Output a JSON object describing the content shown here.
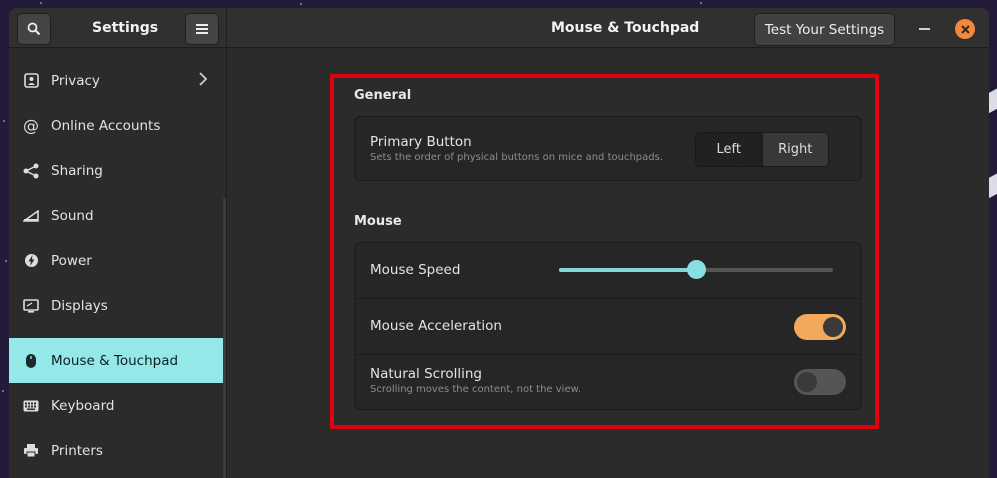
{
  "header": {
    "search_icon": "search-icon",
    "menu_icon": "hamburger-menu-icon",
    "sidebar_title": "Settings",
    "page_title": "Mouse & Touchpad",
    "test_button": "Test Your Settings",
    "accent": "#94e8e8",
    "close_color": "#f0883e"
  },
  "sidebar": {
    "items": [
      {
        "label": "Privacy",
        "icon": "privacy-icon"
      },
      {
        "label": "Online Accounts",
        "icon": "at-icon"
      },
      {
        "label": "Sharing",
        "icon": "share-icon"
      },
      {
        "label": "Sound",
        "icon": "sound-icon"
      },
      {
        "label": "Power",
        "icon": "power-icon"
      },
      {
        "label": "Displays",
        "icon": "display-icon"
      },
      {
        "label": "Mouse & Touchpad",
        "icon": "mouse-icon",
        "active": true
      },
      {
        "label": "Keyboard",
        "icon": "keyboard-icon"
      },
      {
        "label": "Printers",
        "icon": "printer-icon"
      }
    ]
  },
  "general": {
    "title": "General",
    "primary_button": {
      "label": "Primary Button",
      "description": "Sets the order of physical buttons on mice and touchpads.",
      "options": [
        "Left",
        "Right"
      ],
      "selected": "Left"
    }
  },
  "mouse": {
    "title": "Mouse",
    "speed": {
      "label": "Mouse Speed",
      "value_fraction": 0.5
    },
    "acceleration": {
      "label": "Mouse Acceleration",
      "enabled": true
    },
    "natural_scrolling": {
      "label": "Natural Scrolling",
      "description": "Scrolling moves the content, not the view.",
      "enabled": false
    }
  },
  "highlight_color": "#e3000f"
}
